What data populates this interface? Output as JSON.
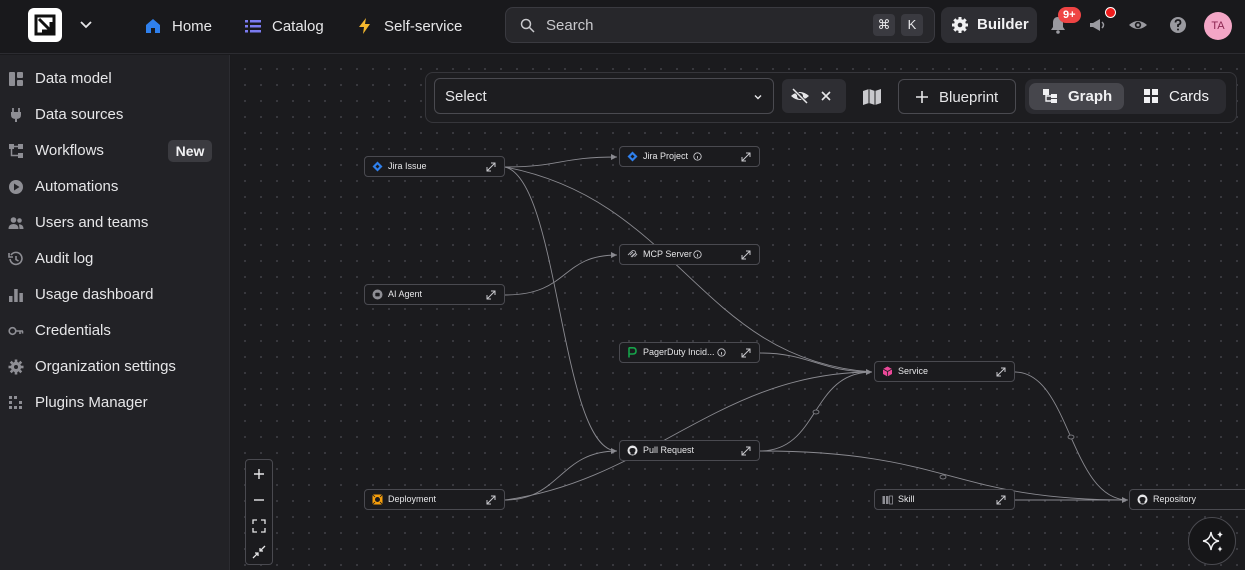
{
  "nav": {
    "home": "Home",
    "catalog": "Catalog",
    "self_service": "Self-service",
    "search_placeholder": "Search",
    "kbd_cmd": "⌘",
    "kbd_k": "K",
    "builder": "Builder",
    "notifications_count": "9+",
    "avatar_initials": "TA"
  },
  "sidebar": {
    "items": [
      {
        "label": "Data model",
        "icon": "data-model-icon"
      },
      {
        "label": "Data sources",
        "icon": "plug-icon"
      },
      {
        "label": "Workflows",
        "icon": "workflow-icon",
        "badge": "New"
      },
      {
        "label": "Automations",
        "icon": "play-circle-icon"
      },
      {
        "label": "Users and teams",
        "icon": "users-icon"
      },
      {
        "label": "Audit log",
        "icon": "history-icon"
      },
      {
        "label": "Usage dashboard",
        "icon": "bar-chart-icon"
      },
      {
        "label": "Credentials",
        "icon": "key-icon"
      },
      {
        "label": "Organization settings",
        "icon": "gear-icon"
      },
      {
        "label": "Plugins Manager",
        "icon": "plugins-icon"
      }
    ]
  },
  "toolbar": {
    "select_value": "Select",
    "blueprint": "Blueprint",
    "graph": "Graph",
    "cards": "Cards"
  },
  "graph": {
    "nodes": [
      {
        "id": "jira-issue",
        "label": "Jira Issue"
      },
      {
        "id": "jira-project",
        "label": "Jira Project"
      },
      {
        "id": "mcp-server",
        "label": "MCP Server"
      },
      {
        "id": "ai-agent",
        "label": "AI Agent"
      },
      {
        "id": "pagerduty",
        "label": "PagerDuty Incid..."
      },
      {
        "id": "service",
        "label": "Service"
      },
      {
        "id": "pull-request",
        "label": "Pull Request"
      },
      {
        "id": "deployment",
        "label": "Deployment"
      },
      {
        "id": "skill",
        "label": "Skill"
      },
      {
        "id": "repository",
        "label": "Repository"
      }
    ]
  },
  "colors": {
    "accent_blue": "#2f80ed",
    "catalog_purple": "#7b7bf0",
    "self_service_yellow": "#f5b82e",
    "service_pink": "#ec4899",
    "pagerduty_green": "#16a34a",
    "deployment_orange": "#f59e0b"
  }
}
